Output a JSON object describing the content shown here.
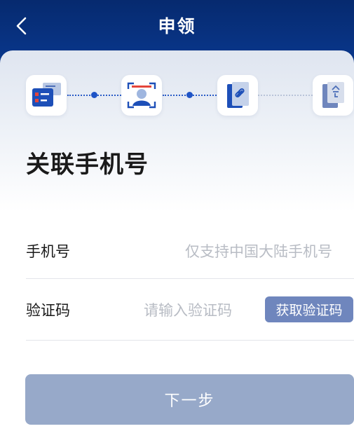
{
  "header": {
    "title": "申领"
  },
  "steps": [
    {
      "icon": "id-card-icon",
      "done": true
    },
    {
      "icon": "face-scan-icon",
      "done": true
    },
    {
      "icon": "link-phone-icon",
      "done": true
    },
    {
      "icon": "passcode-phone-icon",
      "done": false
    }
  ],
  "main": {
    "heading": "关联手机号",
    "phone": {
      "label": "手机号",
      "placeholder": "仅支持中国大陆手机号"
    },
    "code": {
      "label": "验证码",
      "placeholder": "请输入验证码",
      "button": "获取验证码"
    },
    "next_button": "下一步"
  },
  "colors": {
    "header_bg": "#0a3a93",
    "accent": "#1f54c6",
    "button_disabled": "#97a9c9",
    "code_button": "#6f86bd"
  }
}
